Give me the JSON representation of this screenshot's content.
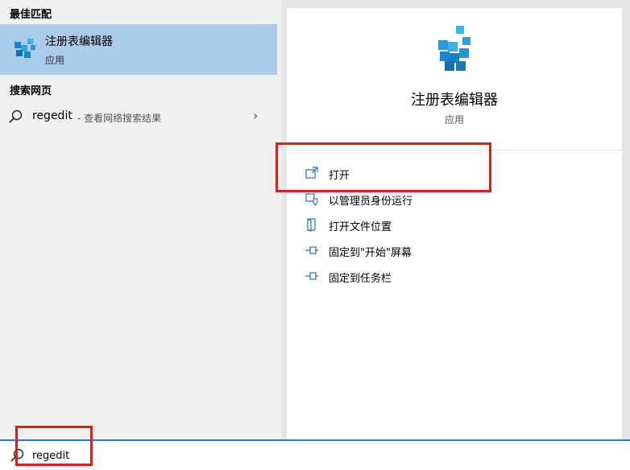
{
  "left": {
    "best_match_header": "最佳匹配",
    "best_match": {
      "title": "注册表编辑器",
      "subtitle": "应用"
    },
    "web_header": "搜索网页",
    "web_result": {
      "query": "regedit",
      "suffix": "- 查看网络搜索结果"
    }
  },
  "right": {
    "app_title": "注册表编辑器",
    "app_subtitle": "应用",
    "actions": [
      {
        "label": "打开",
        "icon": "open-icon"
      },
      {
        "label": "以管理员身份运行",
        "icon": "shield-icon"
      },
      {
        "label": "打开文件位置",
        "icon": "file-location-icon"
      },
      {
        "label": "固定到\"开始\"屏幕",
        "icon": "pin-icon"
      },
      {
        "label": "固定到任务栏",
        "icon": "pin-icon"
      }
    ]
  },
  "search": {
    "value": "regedit"
  },
  "colors": {
    "accent": "#2c78c8",
    "selection": "#aacbe9",
    "highlight": "#e21b1b"
  }
}
